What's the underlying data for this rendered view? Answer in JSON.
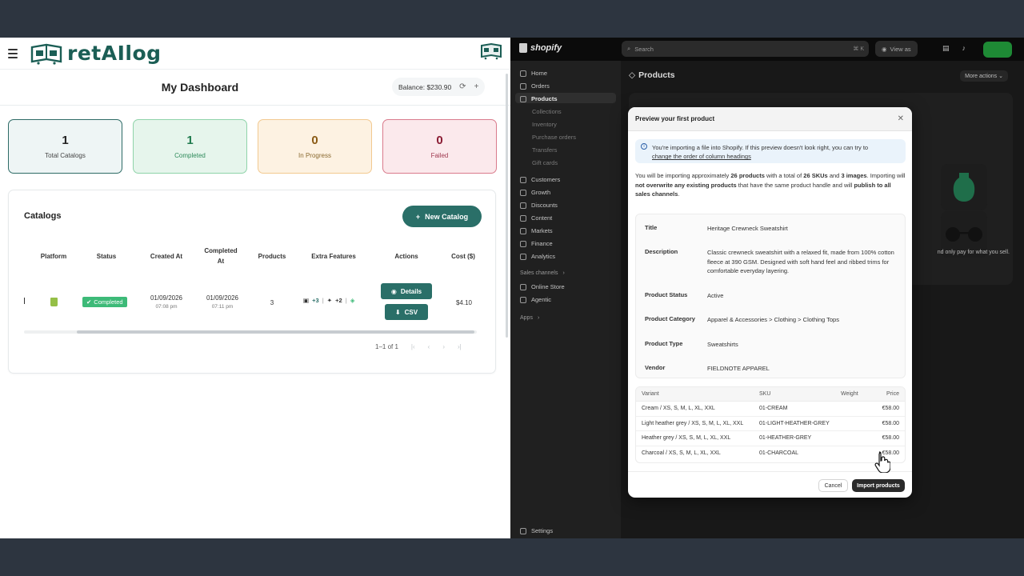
{
  "left_app": {
    "logo": {
      "prefix": "ret",
      "ai": "AI",
      "suffix": "log"
    },
    "header": {
      "title": "My Dashboard",
      "balance": "Balance: $230.90"
    },
    "stats": [
      {
        "value": "1",
        "label": "Total Catalogs"
      },
      {
        "value": "1",
        "label": "Completed"
      },
      {
        "value": "0",
        "label": "In Progress"
      },
      {
        "value": "0",
        "label": "Failed"
      }
    ],
    "catalogs": {
      "title": "Catalogs",
      "new_button": "New Catalog",
      "columns": [
        "Platform",
        "Status",
        "Created At",
        "Completed At",
        "Products",
        "Extra Features",
        "Actions",
        "Cost ($)"
      ],
      "rows": [
        {
          "status": "Completed",
          "created_date": "01/09/2026",
          "created_time": "07:08 pm",
          "completed_date": "01/09/2026",
          "completed_time": "07:11 pm",
          "products": "3",
          "extra_images": "+3",
          "extra_ai": "+2",
          "details_button": "Details",
          "csv_button": "CSV",
          "cost": "$4.10"
        }
      ],
      "pagination": "1–1 of 1"
    }
  },
  "shopify": {
    "brand": "shopify",
    "search_placeholder": "Search",
    "search_shortcut": "⌘ K",
    "view_as": "View as",
    "nav": {
      "home": "Home",
      "orders": "Orders",
      "products": "Products",
      "collections": "Collections",
      "inventory": "Inventory",
      "purchase_orders": "Purchase orders",
      "transfers": "Transfers",
      "gift_cards": "Gift cards",
      "customers": "Customers",
      "growth": "Growth",
      "discounts": "Discounts",
      "content": "Content",
      "markets": "Markets",
      "finance": "Finance",
      "analytics": "Analytics",
      "sales_channels": "Sales channels",
      "online_store": "Online Store",
      "agentic": "Agentic",
      "apps": "Apps",
      "settings": "Settings"
    },
    "page_title": "Products",
    "more_actions": "More actions",
    "background_text": "nd only pay for what you sell.",
    "modal": {
      "title": "Preview your first product",
      "info_text": "You're importing a file into Shopify. If this preview doesn't look right, you can try to",
      "info_link": "change the order of column headings",
      "para_1": "You will be importing approximately",
      "product_count": "26 products",
      "para_2": "with a total of",
      "sku_count": "26 SKUs",
      "para_3": "and",
      "image_count": "3 images",
      "para_4": ". Importing will",
      "no_overwrite": "not overwrite any existing products",
      "para_5": "that have the same product handle and will",
      "publish": "publish to all sales channels",
      "fields": [
        {
          "label": "Title",
          "value": "Heritage Crewneck Sweatshirt"
        },
        {
          "label": "Description",
          "value": "Classic crewneck sweatshirt with a relaxed fit, made from 100% cotton fleece at 390 GSM. Designed with soft hand feel and ribbed trims for comfortable everyday layering."
        },
        {
          "label": "Product Status",
          "value": "Active"
        },
        {
          "label": "Product Category",
          "value": "Apparel & Accessories > Clothing > Clothing Tops"
        },
        {
          "label": "Product Type",
          "value": "Sweatshirts"
        },
        {
          "label": "Vendor",
          "value": "FIELDNOTE APPAREL"
        }
      ],
      "variant_columns": {
        "variant": "Variant",
        "sku": "SKU",
        "weight": "Weight",
        "price": "Price"
      },
      "variants": [
        {
          "variant": "Cream / XS, S, M, L, XL, XXL",
          "sku": "01-CREAM",
          "price": "€58.00"
        },
        {
          "variant": "Light heather grey / XS, S, M, L, XL, XXL",
          "sku": "01-LIGHT-HEATHER-GREY",
          "price": "€58.00"
        },
        {
          "variant": "Heather grey / XS, S, M, L, XL, XXL",
          "sku": "01-HEATHER-GREY",
          "price": "€58.00"
        },
        {
          "variant": "Charcoal / XS, S, M, L, XL, XXL",
          "sku": "01-CHARCOAL",
          "price": "€58.00"
        }
      ],
      "cancel": "Cancel",
      "import": "Import products"
    }
  },
  "colors": {
    "teal": "#2a6f68",
    "completed_green": "#3dba78",
    "shopify_green": "#95bf47"
  }
}
